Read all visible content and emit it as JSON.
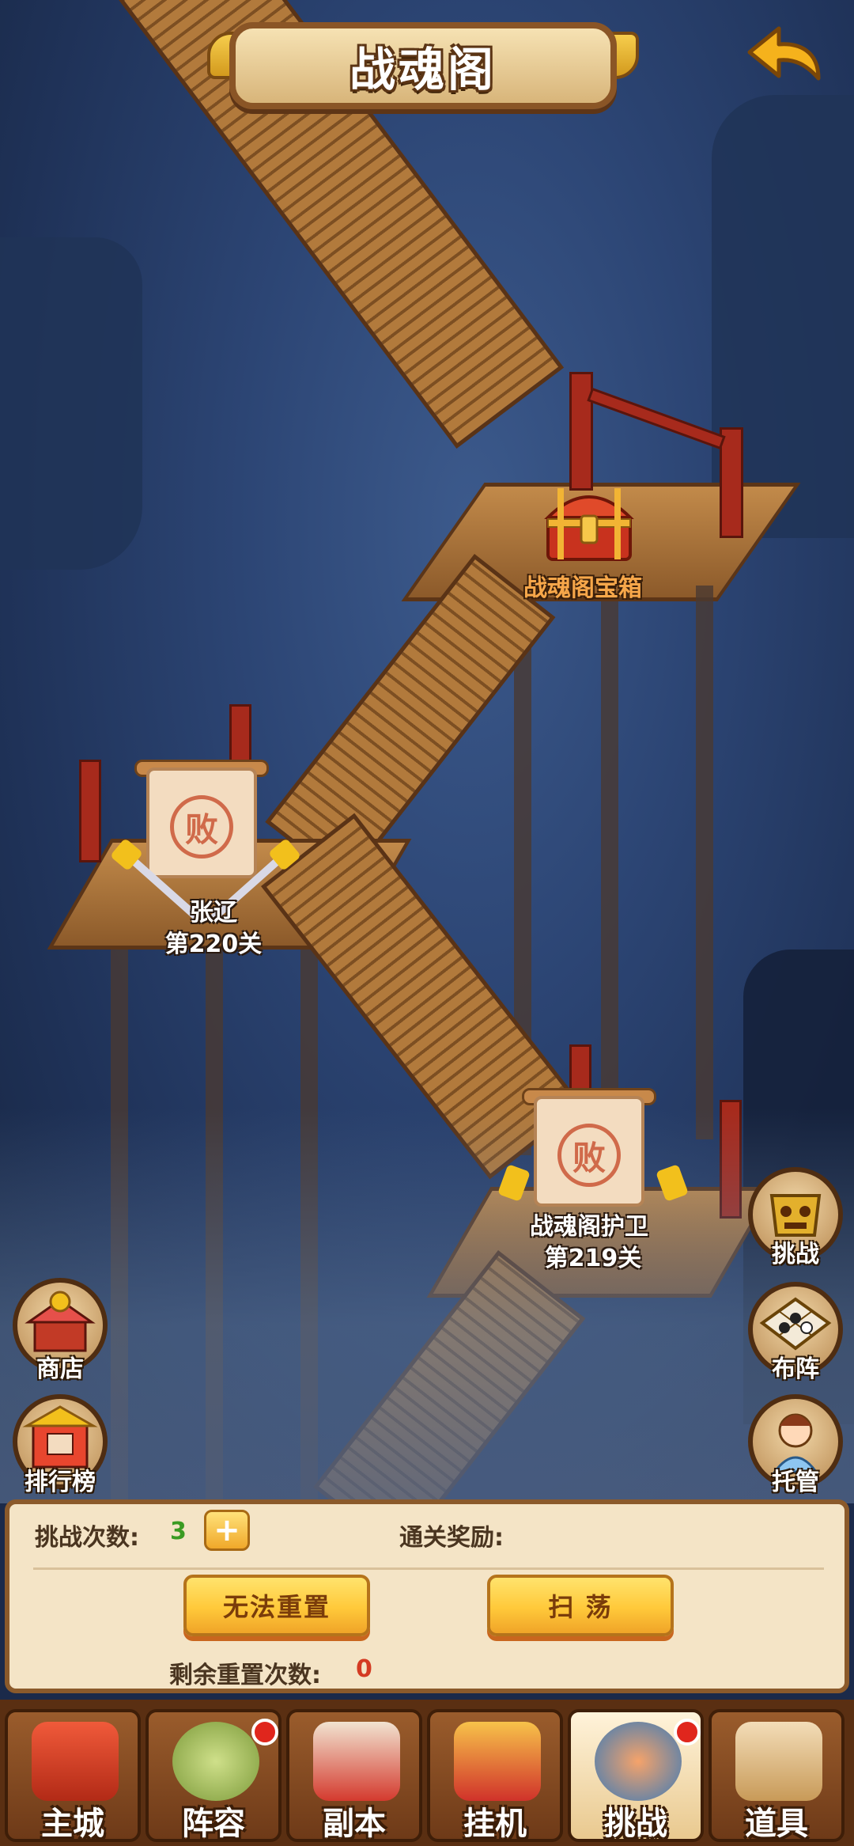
{
  "header": {
    "title": "战魂阁"
  },
  "nodes": {
    "chest": {
      "label": "战魂阁宝箱"
    },
    "level_220": {
      "seal": "败",
      "name": "张辽",
      "stage": "第220关"
    },
    "level_219": {
      "seal": "败",
      "name": "战魂阁护卫",
      "stage": "第219关"
    }
  },
  "side_left": [
    {
      "label": "商店",
      "icon": "shop-icon"
    },
    {
      "label": "排行榜",
      "icon": "ranking-icon"
    }
  ],
  "side_right": [
    {
      "label": "挑战",
      "icon": "challenge-icon"
    },
    {
      "label": "布阵",
      "icon": "formation-icon"
    },
    {
      "label": "托管",
      "icon": "auto-icon"
    }
  ],
  "panel": {
    "challenge_count_label": "挑战次数:",
    "challenge_count": "3",
    "plus": "+",
    "reward_label": "通关奖励:",
    "reset_button": "无法重置",
    "sweep_button": "扫 荡",
    "remaining_resets_label": "剩余重置次数:",
    "remaining_resets": "0"
  },
  "tabs": [
    {
      "label": "主城",
      "icon": "city-icon",
      "badge": false
    },
    {
      "label": "阵容",
      "icon": "lineup-icon",
      "badge": true
    },
    {
      "label": "副本",
      "icon": "dungeon-icon",
      "badge": false
    },
    {
      "label": "挂机",
      "icon": "idle-icon",
      "badge": false
    },
    {
      "label": "挑战",
      "icon": "challenge-tab-icon",
      "badge": true,
      "active": true
    },
    {
      "label": "道具",
      "icon": "items-icon",
      "badge": false
    }
  ],
  "colors": {
    "accent_gold": "#ffc93a",
    "count_green": "#3b9b22",
    "count_red": "#d43a22",
    "chest_label": "#f7a74a"
  }
}
